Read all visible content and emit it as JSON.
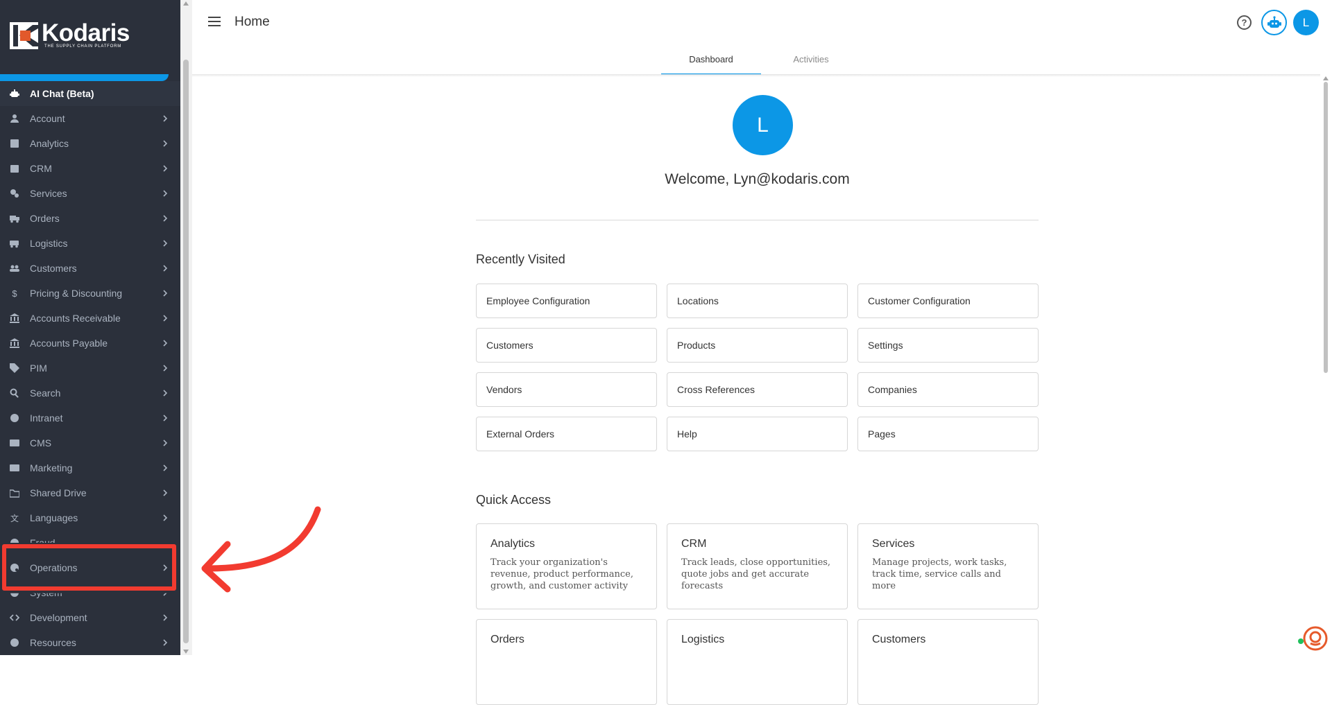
{
  "brand": {
    "name": "Kodaris",
    "tagline": "THE SUPPLY CHAIN PLATFORM",
    "accent_color": "#0c97e6",
    "sidebar_color": "#2b303b",
    "highlight_color": "#f23b30"
  },
  "sidebar": {
    "items": [
      {
        "label": "AI Chat (Beta)",
        "icon": "robot-icon"
      },
      {
        "label": "Account",
        "icon": "person-icon"
      },
      {
        "label": "Analytics",
        "icon": "chart-icon"
      },
      {
        "label": "CRM",
        "icon": "contact-card-icon"
      },
      {
        "label": "Services",
        "icon": "gears-icon"
      },
      {
        "label": "Orders",
        "icon": "truck-icon"
      },
      {
        "label": "Logistics",
        "icon": "van-icon"
      },
      {
        "label": "Customers",
        "icon": "people-icon"
      },
      {
        "label": "Pricing & Discounting",
        "icon": "dollar-icon"
      },
      {
        "label": "Accounts Receivable",
        "icon": "bank-icon"
      },
      {
        "label": "Accounts Payable",
        "icon": "bank-icon"
      },
      {
        "label": "PIM",
        "icon": "tag-icon"
      },
      {
        "label": "Search",
        "icon": "search-icon"
      },
      {
        "label": "Intranet",
        "icon": "globe-icon"
      },
      {
        "label": "CMS",
        "icon": "window-icon"
      },
      {
        "label": "Marketing",
        "icon": "id-card-icon"
      },
      {
        "label": "Shared Drive",
        "icon": "folder-icon"
      },
      {
        "label": "Languages",
        "icon": "translate-icon"
      },
      {
        "label": "Fraud",
        "icon": "shield-icon"
      },
      {
        "label": "Operations",
        "icon": "palette-icon"
      },
      {
        "label": "System",
        "icon": "gear-icon"
      },
      {
        "label": "Development",
        "icon": "code-icon"
      },
      {
        "label": "Resources",
        "icon": "help-circle-icon"
      }
    ]
  },
  "header": {
    "title": "Home",
    "help_glyph": "?",
    "user_initial": "L"
  },
  "tabs": [
    {
      "label": "Dashboard",
      "active": true
    },
    {
      "label": "Activities",
      "active": false
    }
  ],
  "dashboard": {
    "avatar_initial": "L",
    "welcome": "Welcome, Lyn@kodaris.com",
    "recently_visited_title": "Recently Visited",
    "recently_visited": [
      "Employee Configuration",
      "Locations",
      "Customer Configuration",
      "Customers",
      "Products",
      "Settings",
      "Vendors",
      "Cross References",
      "Companies",
      "External Orders",
      "Help",
      "Pages"
    ],
    "quick_access_title": "Quick Access",
    "quick_access": [
      {
        "title": "Analytics",
        "desc": "Track your organization's revenue, product performance, growth, and customer activity"
      },
      {
        "title": "CRM",
        "desc": "Track leads, close opportunities, quote jobs and get accurate forecasts"
      },
      {
        "title": "Services",
        "desc": "Manage projects, work tasks, track time, service calls and more"
      },
      {
        "title": "Orders",
        "desc": ""
      },
      {
        "title": "Logistics",
        "desc": ""
      },
      {
        "title": "Customers",
        "desc": ""
      }
    ]
  }
}
